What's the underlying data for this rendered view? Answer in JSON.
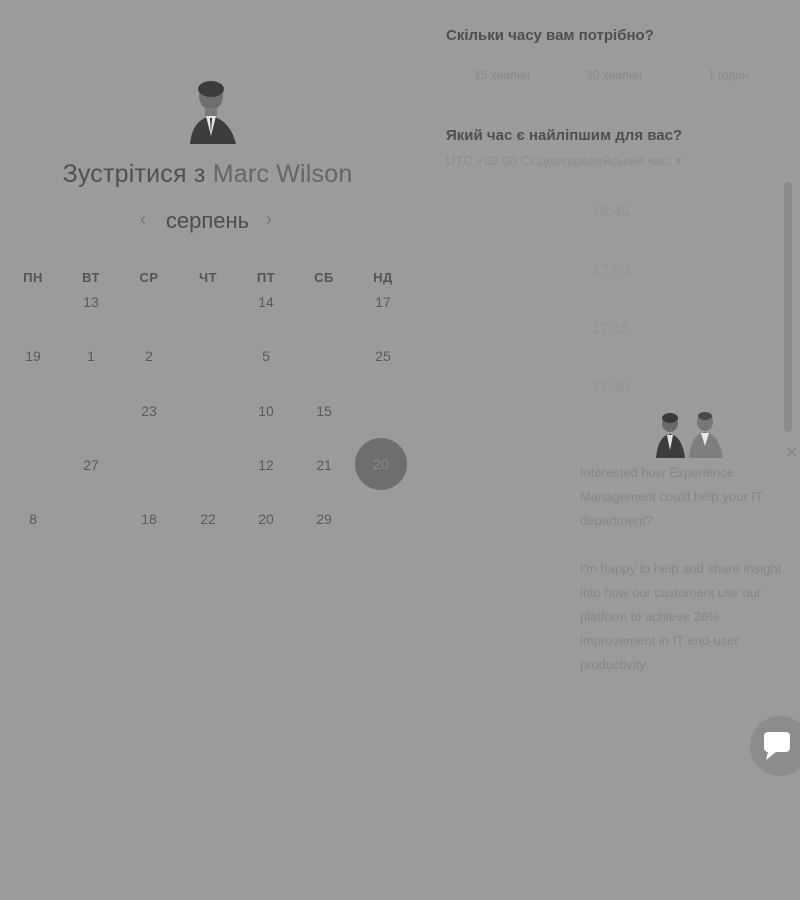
{
  "header": {
    "title_prefix": "Зустрітися з",
    "host_name": "Marc Wilson"
  },
  "calendar": {
    "month": "серпень",
    "prev_icon": "chevron-left-icon",
    "next_icon": "chevron-right-icon",
    "weekdays": [
      "ПН",
      "ВТ",
      "СР",
      "ЧТ",
      "ПТ",
      "СБ",
      "НД"
    ],
    "weeks": [
      [
        "",
        "13",
        "",
        "",
        "14",
        "",
        "17"
      ],
      [
        "19",
        "1",
        "2",
        "",
        "5",
        "",
        "25"
      ],
      [
        "",
        "",
        "23",
        "",
        "10",
        "15",
        ""
      ],
      [
        "",
        "27",
        "",
        "",
        "12",
        "21",
        "20"
      ],
      [
        "8",
        "",
        "18",
        "22",
        "20",
        "29",
        ""
      ]
    ],
    "selected": "20"
  },
  "booking": {
    "duration_question": "Скільки часу вам потрібно?",
    "durations": [
      "15 хвилин",
      "30 хвилин",
      "1 годин"
    ],
    "time_question": "Який час є найліпшим для вас?",
    "timezone": "UTC +03:00 Східноєвропейський час",
    "timezone_icon": "chevron-down-icon",
    "slots": [
      "16:45",
      "17:00",
      "17:15",
      "17:30"
    ]
  },
  "chat": {
    "message_1": "Interested how Experience Management could help your IT department?",
    "message_2": "I'm happy to help and share insight into how our customers use our platform to achieve 26% improvement in IT end-user productivity.",
    "close_icon": "close-icon",
    "launcher_icon": "chat-bubble-icon"
  },
  "colors": {
    "overlay": "#9b9b9b",
    "selected_day": "#6e6e6e"
  }
}
